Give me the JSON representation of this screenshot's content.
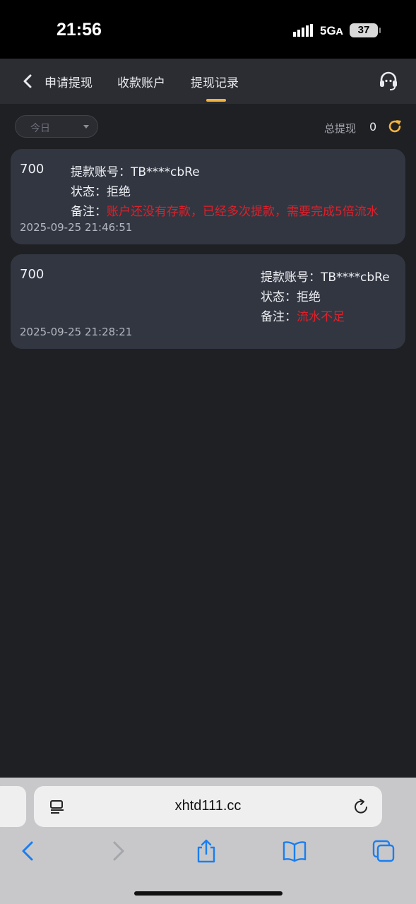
{
  "status_bar": {
    "time": "21:56",
    "network": "5Gᴀ",
    "battery": "37"
  },
  "header": {
    "back_icon": "chevron-left-icon",
    "tabs": [
      {
        "label": "申请提现"
      },
      {
        "label": "收款账户"
      },
      {
        "label": "提现记录",
        "active": true
      }
    ],
    "support_icon": "headset-icon",
    "accent_color": "#f2b33d"
  },
  "filter": {
    "date_label": "今日",
    "total_label": "总提现",
    "total_value": "0",
    "refresh_icon": "refresh-icon"
  },
  "records": [
    {
      "amount": "700",
      "account_label": "提款账号：",
      "account_value": "TB****cbRe",
      "status_label": "状态：",
      "status_value": "拒绝",
      "note_label": "备注：",
      "note_value": "账户还没有存款，已经多次提款，需要完成5倍流水",
      "time": "2025-09-25 21:46:51"
    },
    {
      "amount": "700",
      "account_label": "提款账号：",
      "account_value": "TB****cbRe",
      "status_label": "状态：",
      "status_value": "拒绝",
      "note_label": "备注：",
      "note_value": "流水不足",
      "time": "2025-09-25 21:28:21"
    }
  ],
  "browser": {
    "url": "xhtd111.cc",
    "reader_icon": "reader-mode-icon",
    "reload_icon": "reload-icon",
    "nav": [
      "back-icon",
      "forward-icon",
      "share-icon",
      "bookmarks-icon",
      "tabs-icon"
    ]
  },
  "colors": {
    "background": "#1f2024",
    "card": "#323641",
    "note_red": "#e0202a"
  }
}
